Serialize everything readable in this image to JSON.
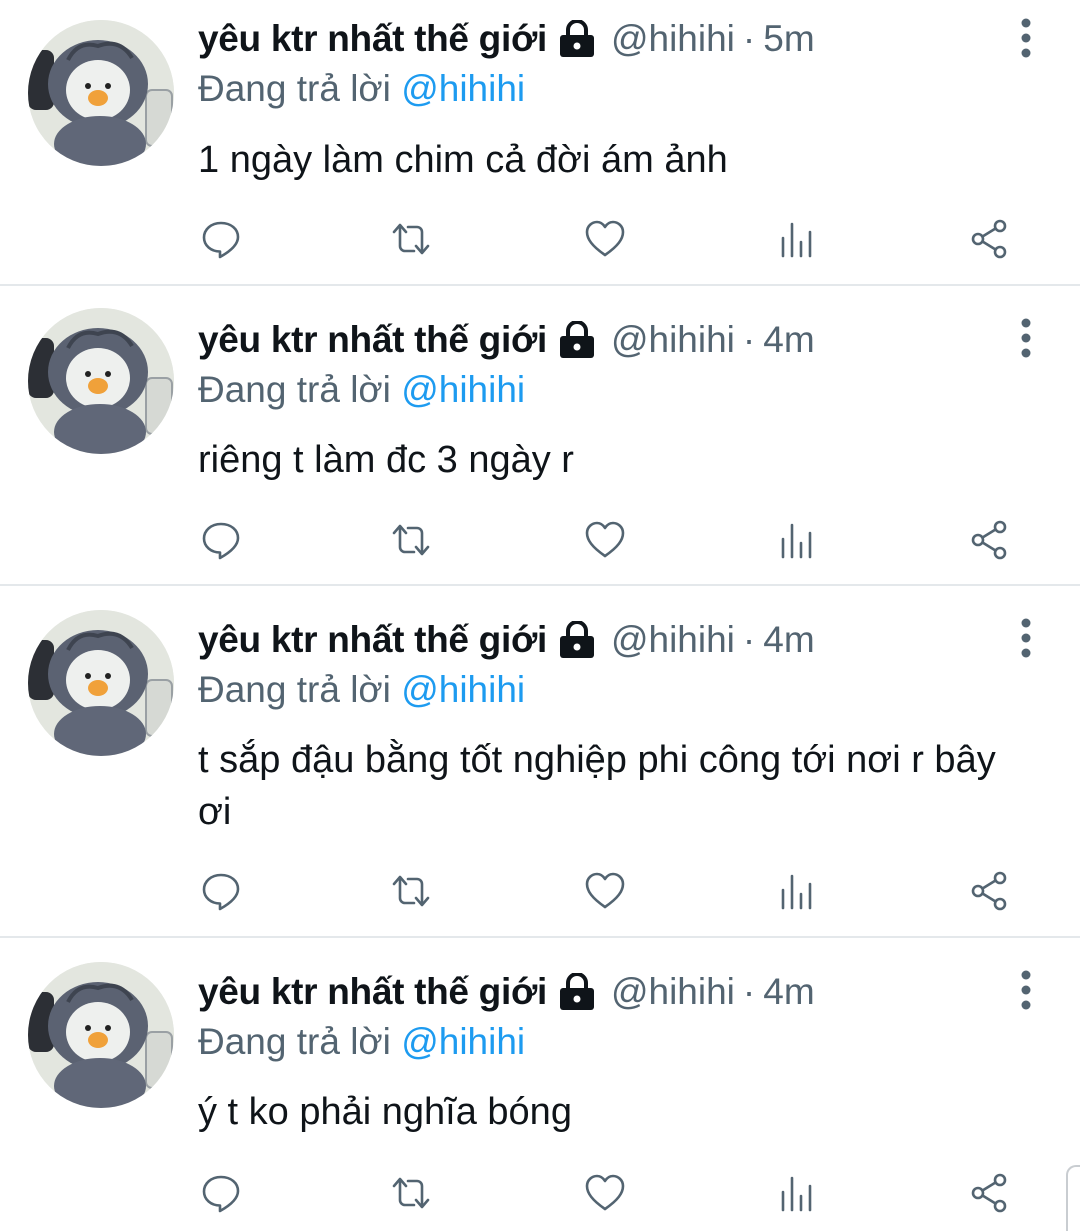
{
  "tweets": [
    {
      "display_name": "yêu ktr nhất thế giới",
      "handle": "@hihihi",
      "separator": "·",
      "time": "5m",
      "replying_prefix": "Đang trả lời",
      "replying_to": "@hihihi",
      "text": "1 ngày làm chim cả đời ám ảnh"
    },
    {
      "display_name": "yêu ktr nhất thế giới",
      "handle": "@hihihi",
      "separator": "·",
      "time": "4m",
      "replying_prefix": "Đang trả lời",
      "replying_to": "@hihihi",
      "text": "riêng t làm đc 3 ngày r"
    },
    {
      "display_name": "yêu ktr nhất thế giới",
      "handle": "@hihihi",
      "separator": "·",
      "time": "4m",
      "replying_prefix": "Đang trả lời",
      "replying_to": "@hihihi",
      "text": "t sắp đậu bằng tốt nghiệp phi công tới nơi r bây ơi"
    },
    {
      "display_name": "yêu ktr nhất thế giới",
      "handle": "@hihihi",
      "separator": "·",
      "time": "4m",
      "replying_prefix": "Đang trả lời",
      "replying_to": "@hihihi",
      "text": "ý t ko phải nghĩa bóng"
    }
  ],
  "icons": {
    "lock": "lock-icon",
    "more": "more-vertical-icon",
    "reply": "reply-bubble-icon",
    "retweet": "retweet-icon",
    "like": "heart-icon",
    "stats": "analytics-icon",
    "share": "share-icon"
  },
  "colors": {
    "text": "#0f1419",
    "secondary": "#536471",
    "mention": "#1d9bf0",
    "divider": "#e4e8eb"
  }
}
